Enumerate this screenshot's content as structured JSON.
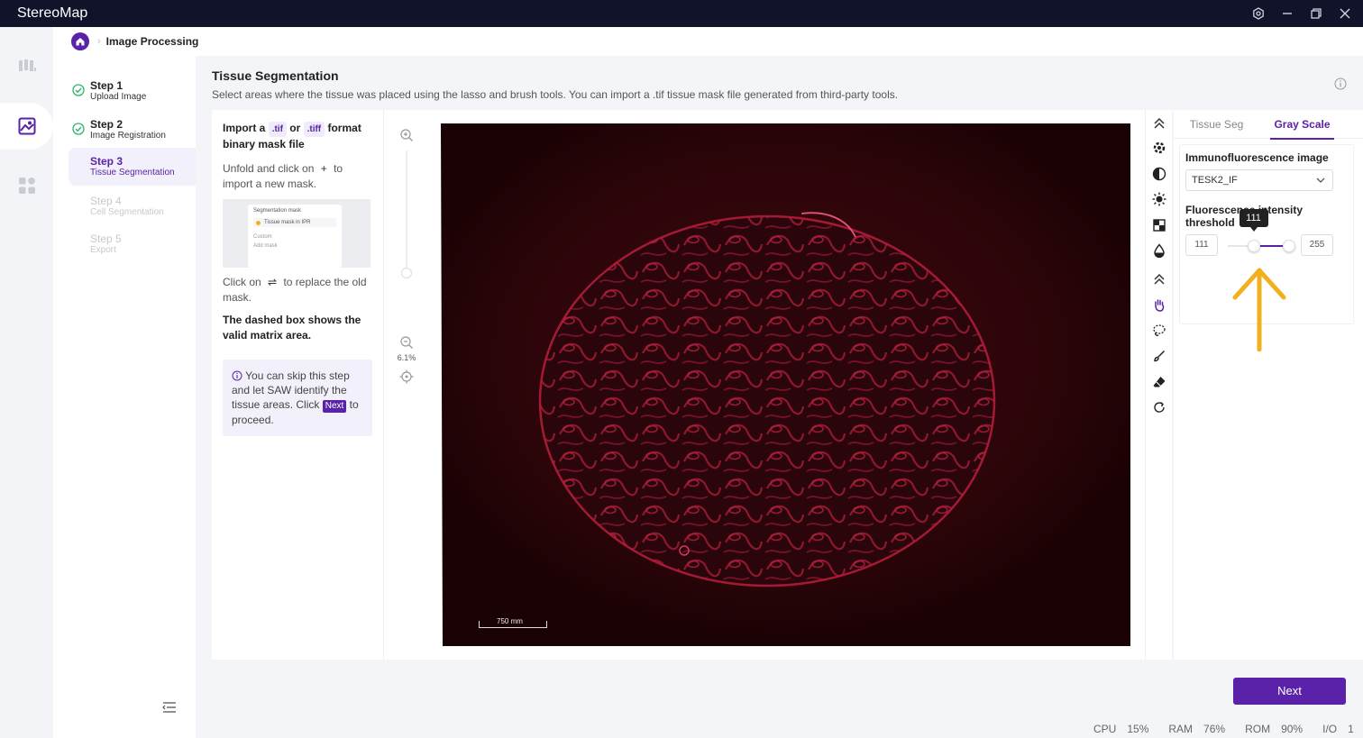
{
  "app": {
    "title": "StereoMap"
  },
  "breadcrumb": {
    "title": "Image Processing"
  },
  "steps": [
    {
      "name": "Step 1",
      "sub": "Upload Image",
      "state": "done"
    },
    {
      "name": "Step 2",
      "sub": "Image Registration",
      "state": "done"
    },
    {
      "name": "Step 3",
      "sub": "Tissue Segmentation",
      "state": "active"
    },
    {
      "name": "Step 4",
      "sub": "Cell Segmentation",
      "state": "disabled"
    },
    {
      "name": "Step 5",
      "sub": "Export",
      "state": "disabled"
    }
  ],
  "main": {
    "title": "Tissue Segmentation",
    "description": "Select areas where the tissue was placed using the lasso and brush tools. You can import a .tif tissue mask file generated from third-party tools."
  },
  "help": {
    "import_prefix": "Import a",
    "chip_tif": ".tif",
    "or": "or",
    "chip_tiff": ".tiff",
    "import_suffix": "format binary mask file",
    "unfold_prefix": "Unfold and click on",
    "unfold_symbol": "+",
    "unfold_suffix": "to import a new mask.",
    "preview_title": "Segmentation mask",
    "preview_item": "Tissue mask in IPR",
    "preview_custom": "Custom",
    "preview_add": "Add mask",
    "replace_prefix": "Click on",
    "replace_symbol": "⇌",
    "replace_suffix": "to replace the old mask.",
    "dashed": "The dashed box shows the valid matrix area.",
    "tip_prefix": "You can skip this step and let SAW identify the tissue areas. Click",
    "tip_next": "Next",
    "tip_suffix": "to proceed."
  },
  "zoom": {
    "level": "6.1%"
  },
  "image": {
    "scale_label": "750 mm"
  },
  "right_panel": {
    "tabs": [
      "Tissue Seg",
      "Gray Scale"
    ],
    "active_tab": "Gray Scale",
    "if_label": "Immunofluorescence image",
    "if_value": "TESK2_IF",
    "threshold_label_1": "Fluorescence intensity",
    "threshold_label_2": "threshold",
    "min_value": "111",
    "max_value": "255",
    "tooltip": "111",
    "slider_range": [
      0,
      255
    ],
    "slider_low": 111,
    "slider_high": 255
  },
  "footer": {
    "next_label": "Next"
  },
  "status": {
    "cpu_label": "CPU",
    "cpu": "15%",
    "ram_label": "RAM",
    "ram": "76%",
    "rom_label": "ROM",
    "rom": "90%",
    "io_label": "I/O",
    "io": "1"
  },
  "colors": {
    "accent": "#5a22a8",
    "titlebar": "#11132a",
    "tissue": "#c0203a",
    "arrow": "#f2b01e"
  }
}
